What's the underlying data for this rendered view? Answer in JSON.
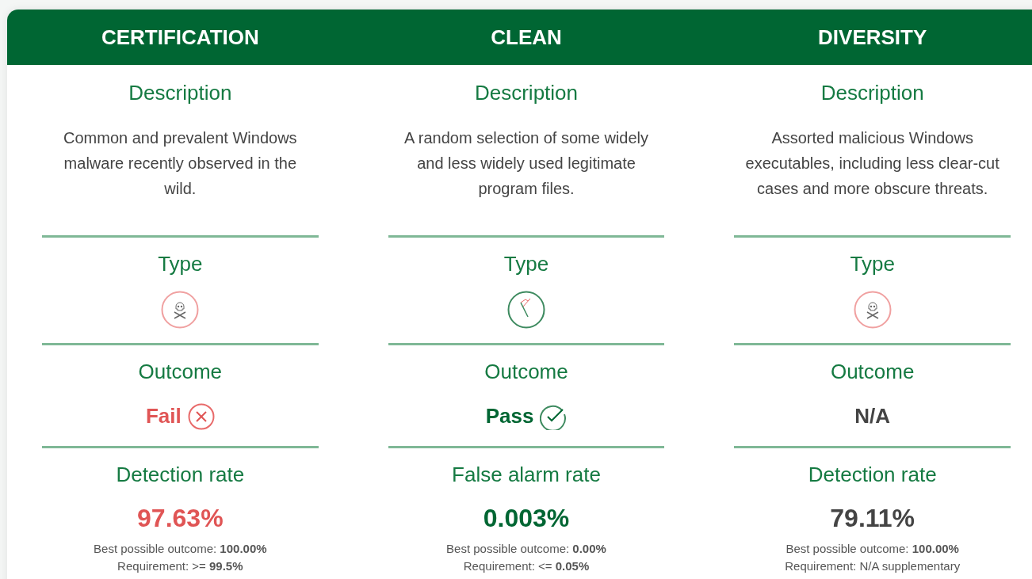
{
  "columns": [
    {
      "title": "CERTIFICATION",
      "description_label": "Description",
      "description": "Common and prevalent Windows malware recently observed in the wild.",
      "type_label": "Type",
      "type_icon": {
        "kind": "malware"
      },
      "outcome_label": "Outcome",
      "outcome": {
        "kind": "fail",
        "text": "Fail"
      },
      "rate_label": "Detection rate",
      "rate": "97.63%",
      "best": "Best possible outcome: **100.00%**",
      "requirement": "Requirement: >= **99.5%**"
    },
    {
      "title": "CLEAN",
      "description_label": "Description",
      "description": "A random selection of some widely and less widely used legitimate program files.",
      "type_label": "Type",
      "type_icon": {
        "kind": "clean"
      },
      "outcome_label": "Outcome",
      "outcome": {
        "kind": "pass",
        "text": "Pass"
      },
      "rate_label": "False alarm rate",
      "rate": "0.003%",
      "best": "Best possible outcome: **0.00%**",
      "requirement": "Requirement: <= **0.05%**"
    },
    {
      "title": "DIVERSITY",
      "description_label": "Description",
      "description": "Assorted malicious Windows executables, including less clear-cut cases and more obscure threats.",
      "type_label": "Type",
      "type_icon": {
        "kind": "malware"
      },
      "outcome_label": "Outcome",
      "outcome": {
        "kind": "na",
        "text": "N/A"
      },
      "rate_label": "Detection rate",
      "rate": "79.11%",
      "best": "Best possible outcome: **100.00%**",
      "requirement": "Requirement: N/A supplementary"
    }
  ]
}
